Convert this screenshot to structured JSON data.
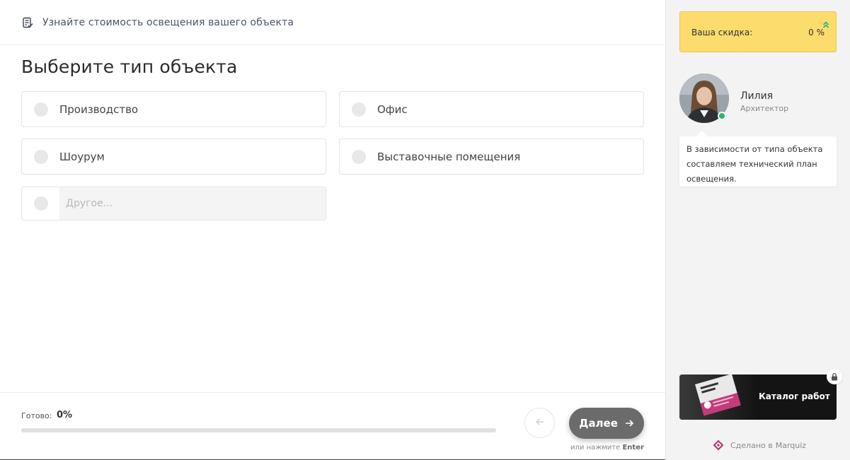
{
  "header": {
    "title": "Узнайте стоимость освещения вашего объекта",
    "icon": "form-document-icon"
  },
  "question": {
    "title": "Выберите тип объекта",
    "options": [
      {
        "label": "Производство"
      },
      {
        "label": "Офис"
      },
      {
        "label": "Шоурум"
      },
      {
        "label": "Выставочные помещения"
      }
    ],
    "other": {
      "placeholder": "Другое...",
      "value": ""
    }
  },
  "footer": {
    "progress_label": "Готово:",
    "progress_text": "0%",
    "progress_fraction": 0,
    "next_label": "Далее",
    "hint_prefix": "или нажмите",
    "hint_key": "Enter"
  },
  "sidebar": {
    "discount_label": "Ваша скидка:",
    "discount_value": "0 %",
    "manager": {
      "name": "Лилия",
      "role": "Архитектор",
      "status": "online"
    },
    "bubble_text": "В зависимости от типа объекта составляем технический план освещения.",
    "catalog_label": "Каталог работ",
    "made_by_prefix": "Сделано в",
    "made_by_brand": "Marquiz"
  },
  "colors": {
    "discount_bg": "#fcdc6c",
    "next_button": "#6b6b6b",
    "online": "#2ab46a",
    "sidebar_bg": "#f3f3f3"
  }
}
